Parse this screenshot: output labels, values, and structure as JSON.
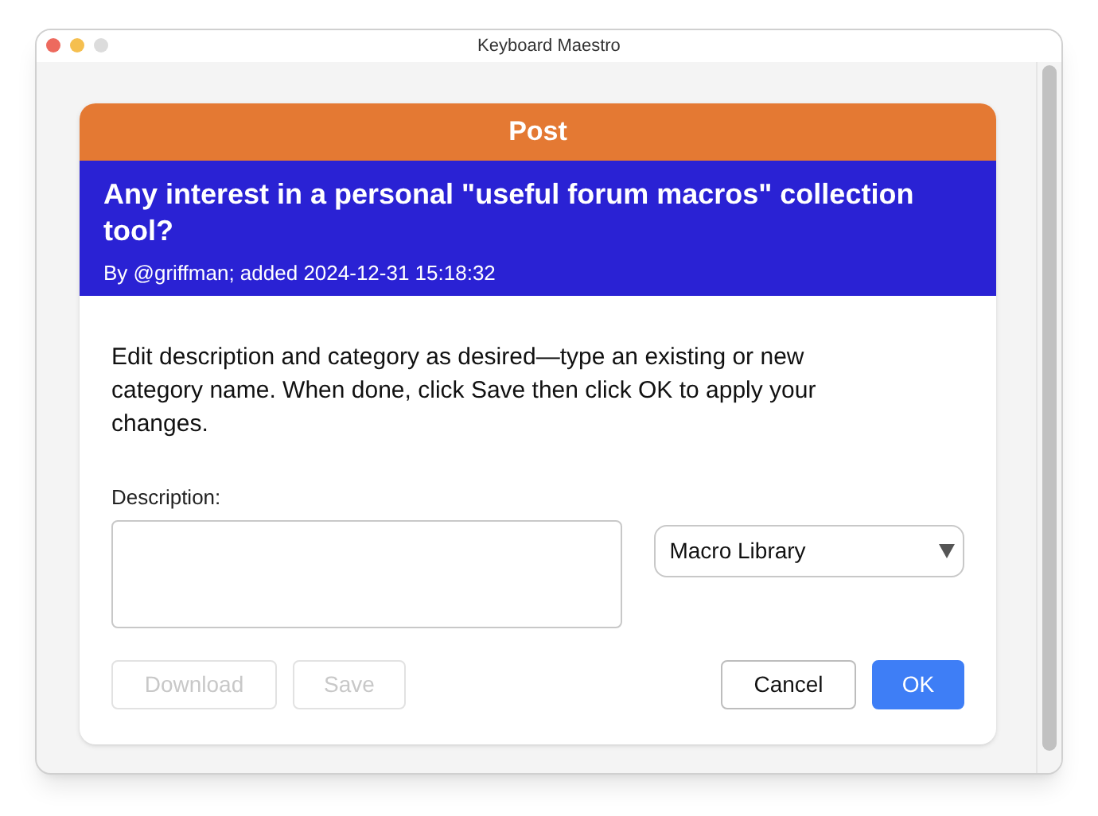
{
  "window": {
    "title": "Keyboard Maestro"
  },
  "header": {
    "label": "Post"
  },
  "post": {
    "title": "Any interest in a personal \"useful forum macros\" collection tool?",
    "byline": "By @griffman; added 2024-12-31 15:18:32"
  },
  "instructions": "Edit description and category as desired—type an existing or new category name. When done, click Save then click OK to apply your changes.",
  "description": {
    "label": "Description:"
  },
  "category": {
    "value": "Macro Library"
  },
  "buttons": [
    {
      "label": "Download",
      "disabled": true,
      "primary": false
    },
    {
      "label": "Save",
      "disabled": true,
      "primary": false
    },
    {
      "label": "Cancel",
      "disabled": false,
      "primary": false
    },
    {
      "label": "OK",
      "disabled": false,
      "primary": true
    }
  ]
}
